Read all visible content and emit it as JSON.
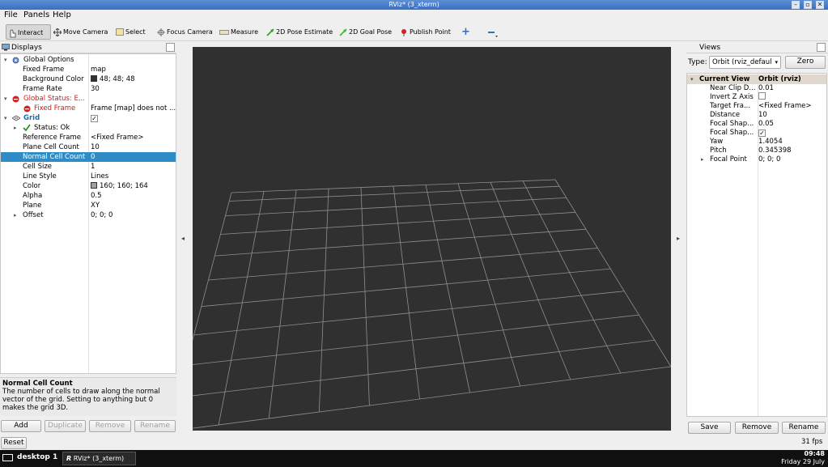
{
  "window": {
    "title": "RViz* (3_xterm)"
  },
  "menu": [
    "File",
    "Panels",
    "Help"
  ],
  "toolbar": {
    "interact": "Interact",
    "move_camera": "Move Camera",
    "select": "Select",
    "focus_camera": "Focus Camera",
    "measure": "Measure",
    "pose_estimate": "2D Pose Estimate",
    "goal_pose": "2D Goal Pose",
    "publish_point": "Publish Point"
  },
  "displays": {
    "title": "Displays",
    "global_options": {
      "label": "Global Options",
      "fixed_frame_k": "Fixed Frame",
      "fixed_frame_v": "map",
      "bg_k": "Background Color",
      "bg_v": "48; 48; 48",
      "bg_color": "#303030",
      "rate_k": "Frame Rate",
      "rate_v": "30"
    },
    "global_status": {
      "label": "Global Status: E...",
      "ff_k": "Fixed Frame",
      "ff_v": "Frame [map] does not ..."
    },
    "grid": {
      "label": "Grid",
      "status": "Status: Ok",
      "ref_k": "Reference Frame",
      "ref_v": "<Fixed Frame>",
      "pcc_k": "Plane Cell Count",
      "pcc_v": "10",
      "ncc_k": "Normal Cell Count",
      "ncc_v": "0",
      "cs_k": "Cell Size",
      "cs_v": "1",
      "ls_k": "Line Style",
      "ls_v": "Lines",
      "color_k": "Color",
      "color_v": "160; 160; 164",
      "color_hex": "#a0a0a4",
      "alpha_k": "Alpha",
      "alpha_v": "0.5",
      "plane_k": "Plane",
      "plane_v": "XY",
      "offset_k": "Offset",
      "offset_v": "0; 0; 0"
    },
    "desc_title": "Normal Cell Count",
    "desc_text": "The number of cells to draw along the normal vector of the grid. Setting to anything but 0 makes the grid 3D.",
    "buttons": {
      "add": "Add",
      "duplicate": "Duplicate",
      "remove": "Remove",
      "rename": "Rename"
    }
  },
  "reset": "Reset",
  "views": {
    "title": "Views",
    "type_label": "Type:",
    "type_value": "Orbit (rviz_defaul",
    "zero": "Zero",
    "current_view_k": "Current View",
    "current_view_v": "Orbit (rviz)",
    "props": [
      {
        "k": "Near Clip D...",
        "v": "0.01"
      },
      {
        "k": "Invert Z Axis",
        "v": ""
      },
      {
        "k": "Target Fra...",
        "v": "<Fixed Frame>"
      },
      {
        "k": "Distance",
        "v": "10"
      },
      {
        "k": "Focal Shap...",
        "v": "0.05"
      },
      {
        "k": "Focal Shap...",
        "v": ""
      },
      {
        "k": "Yaw",
        "v": "1.4054"
      },
      {
        "k": "Pitch",
        "v": "0.345398"
      },
      {
        "k": "Focal Point",
        "v": "0; 0; 0"
      }
    ],
    "buttons": {
      "save": "Save",
      "remove": "Remove",
      "rename": "Rename"
    }
  },
  "fps": "31 fps",
  "taskbar": {
    "desktop": "desktop 1",
    "task": "RViz* (3_xterm)",
    "time": "09:48",
    "date": "Friday 29 July"
  }
}
